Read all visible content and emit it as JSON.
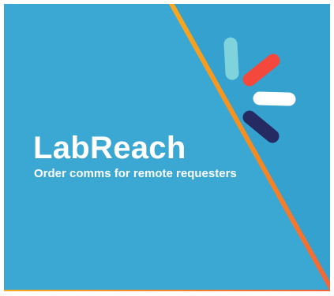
{
  "banner": {
    "title": "LabReach",
    "subtitle": "Order comms for remote requesters"
  },
  "logo": {
    "icon": "burst-icon",
    "colors": {
      "teal": "#7fd3dc",
      "red": "#f4483d",
      "white": "#ffffff",
      "navy": "#262a63"
    }
  },
  "colors": {
    "background": "#3ba8d4",
    "background_right": "#35a1cf",
    "stripe_top": "#f9a91d",
    "stripe_bottom": "#f4633a"
  }
}
